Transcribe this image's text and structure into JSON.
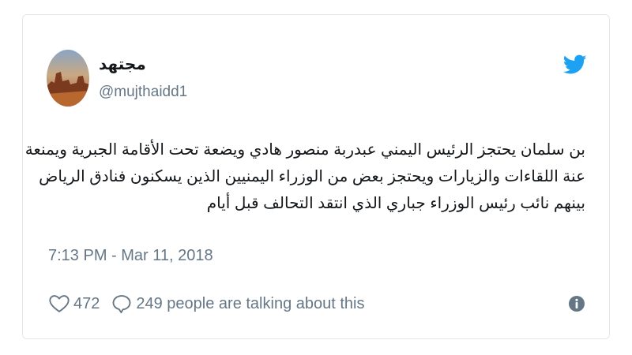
{
  "tweet": {
    "author": {
      "display_name": "مجتهد",
      "handle": "@mujthaidd1",
      "avatar_icon": "avatar-desert-landscape"
    },
    "platform_icon": "twitter-bird-icon",
    "text_lines": [
      "بن سلمان يحتجز الرئيس اليمني عبدربة منصور هادي ويضعة تحت الأقامة الجبرية ويمنعة",
      "عنة اللقاءات والزيارات ويحتجز بعض من الوزراء اليمنيين الذين يسكنون فنادق الرياض",
      "بينهم نائب رئيس الوزراء جباري الذي انتقد التحالف قبل أيام"
    ],
    "timestamp": "7:13 PM - Mar 11, 2018",
    "likes": "472",
    "talking_text": "249 people are talking about this",
    "colors": {
      "brand": "#1da1f2",
      "text": "#14171a",
      "secondary": "#657786",
      "border": "#e1e8ed"
    }
  }
}
